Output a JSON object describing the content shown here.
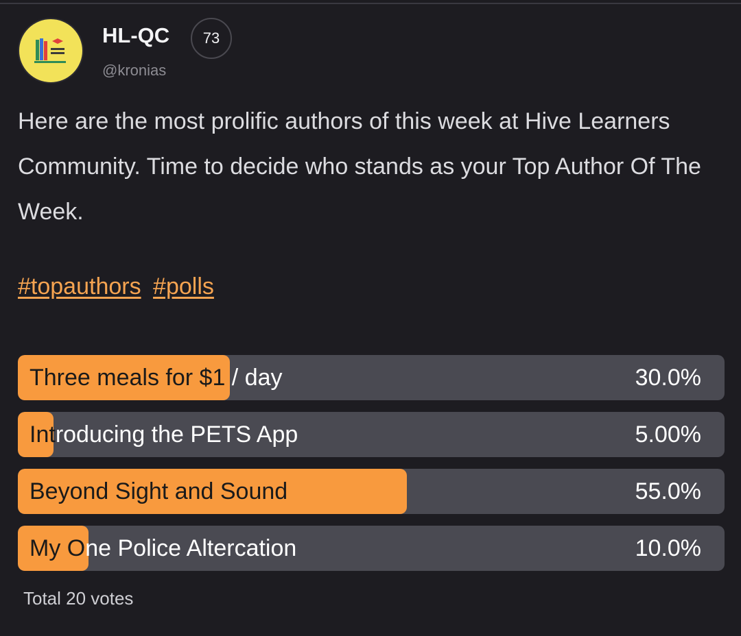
{
  "author": {
    "name": "HL-QC",
    "reputation": "73",
    "handle": "@kronias",
    "avatar_brand": "Hive Learners",
    "avatar_bg": "#f2e259"
  },
  "post": {
    "body": "Here are the most prolific authors of this week at Hive Learners Community. Time to decide who stands as your Top Author Of The Week.",
    "tags": [
      "#topauthors",
      "#polls"
    ],
    "tag_color": "#f6a451"
  },
  "poll": {
    "fill_color": "#f89a3e",
    "track_color": "#4a4a52",
    "options": [
      {
        "label": "Three meals for $1 / day",
        "percent_text": "30.0%",
        "value": 30.0
      },
      {
        "label": "Introducing the PETS App",
        "percent_text": "5.00%",
        "value": 5.0
      },
      {
        "label": "Beyond Sight and Sound",
        "percent_text": "55.0%",
        "value": 55.0
      },
      {
        "label": "My One Police Altercation",
        "percent_text": "10.0%",
        "value": 10.0
      }
    ],
    "total": "Total 20 votes"
  }
}
